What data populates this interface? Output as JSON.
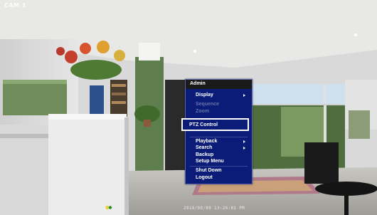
{
  "osd": {
    "top_left": "CAM 1",
    "bottom_timestamp": "2016/08/08 13:26:01 PM"
  },
  "menu": {
    "title": "Admin",
    "items": [
      {
        "label": "Display",
        "enabled": true,
        "submenu": true
      },
      {
        "label": "Sequence",
        "enabled": false,
        "submenu": false
      },
      {
        "label": "Zoom",
        "enabled": false,
        "submenu": false
      },
      {
        "label": "PTZ Control",
        "enabled": true,
        "submenu": false,
        "highlighted": true
      },
      {
        "label": "Playback",
        "enabled": true,
        "submenu": true
      },
      {
        "label": "Search",
        "enabled": true,
        "submenu": true
      },
      {
        "label": "Backup",
        "enabled": true,
        "submenu": false
      },
      {
        "label": "Setup Menu",
        "enabled": true,
        "submenu": false
      },
      {
        "label": "Shut Down",
        "enabled": true,
        "submenu": false
      },
      {
        "label": "Logout",
        "enabled": true,
        "submenu": false
      }
    ]
  },
  "colors": {
    "menu_bg": "#0a1c78",
    "menu_title_bg": "#1a1a1a",
    "disabled_text": "#6873a8",
    "highlight_border": "#ffffff"
  }
}
